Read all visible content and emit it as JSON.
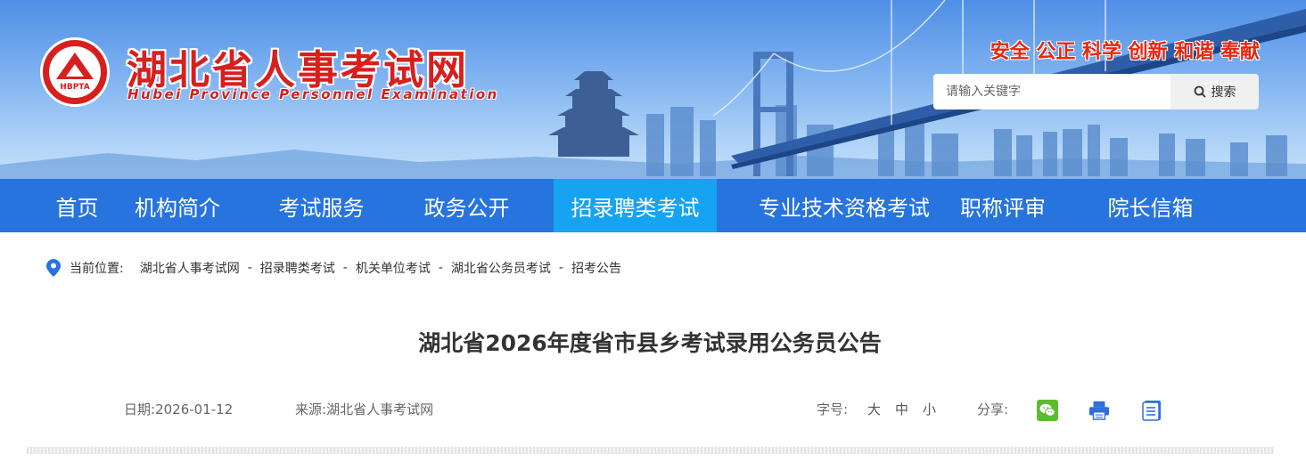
{
  "header": {
    "logo_abbr": "HBPTA",
    "site_name": "湖北省人事考试网",
    "site_name_en": "Hubei Province Personnel Examination",
    "slogan": "安全 公正 科学 创新 和谐 奉献",
    "search": {
      "placeholder": "请输入关键字",
      "button_label": "搜索"
    }
  },
  "nav": {
    "items": [
      {
        "label": "首页"
      },
      {
        "label": "机构简介"
      },
      {
        "label": "考试服务"
      },
      {
        "label": "政务公开"
      },
      {
        "label": "招录聘类考试",
        "active": true
      },
      {
        "label": "专业技术资格考试"
      },
      {
        "label": "职称评审"
      },
      {
        "label": "院长信箱"
      }
    ]
  },
  "breadcrumb": {
    "prefix": "当前位置:",
    "items": [
      "湖北省人事考试网",
      "招录聘类考试",
      "机关单位考试",
      "湖北省公务员考试",
      "招考公告"
    ],
    "separator": "-"
  },
  "article": {
    "title": "湖北省2026年度省市县乡考试录用公务员公告",
    "date_label": "日期:",
    "date": "2026-01-12",
    "source_label": "来源:",
    "source": "湖北省人事考试网",
    "font_size_label": "字号:",
    "font_sizes": [
      "大",
      "中",
      "小"
    ],
    "share_label": "分享:",
    "share_icons": [
      "wechat-icon",
      "print-icon",
      "document-icon"
    ]
  },
  "colors": {
    "nav_bg": "#2774de",
    "nav_active_bg": "#16a3f2",
    "brand_red": "#d7201e",
    "slogan_red": "#e8260e",
    "wechat_green": "#5dbb2f",
    "icon_blue": "#2f6fdc"
  }
}
